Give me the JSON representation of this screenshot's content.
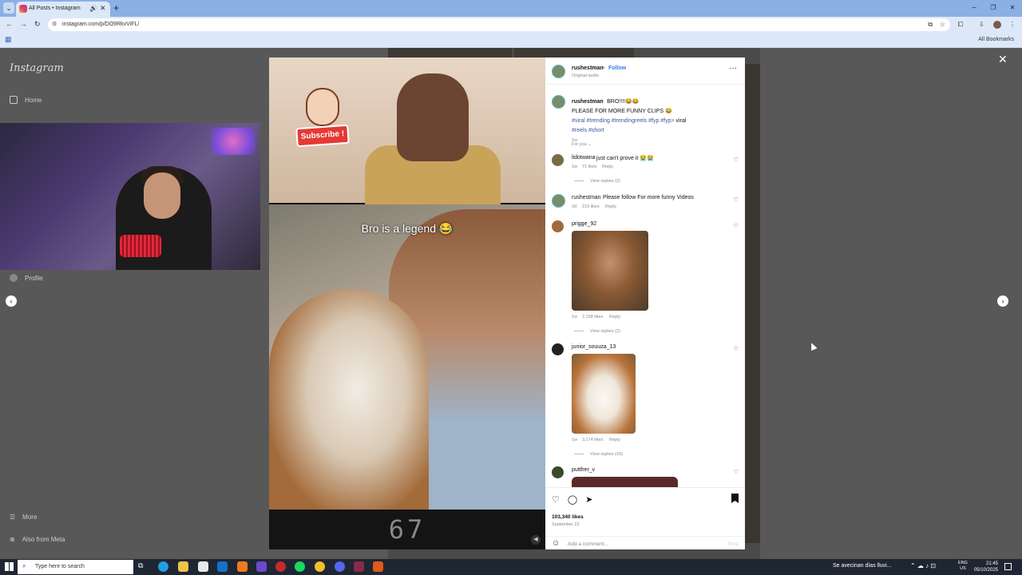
{
  "browser": {
    "tab_title": "All Posts • Instagram",
    "url": "instagram.com/p/DO9RkvViFL/",
    "all_bookmarks": "All Bookmarks"
  },
  "sidebar": {
    "logo": "Instagram",
    "home": "Home",
    "profile": "Profile",
    "more": "More",
    "also_from_meta": "Also from Meta"
  },
  "video": {
    "subscribe_label": "Subscribe !",
    "caption": "Bro is a legend 😂",
    "counter": "67"
  },
  "post": {
    "author": "rushestman",
    "follow": "Follow",
    "audio": "Original audio",
    "caption_text": "BRO!!!!😂😂",
    "caption_line2": "PLEASE FOR MORE FUNNY CLIPS 😂",
    "hashtags_1": "#viral #trending #trendingreels #fyp #fyp>",
    "hashtags_1_tail": " viral",
    "hashtags_2": "#reels #short",
    "caption_time": "1w",
    "for_you": "For you ⌄",
    "likes": "103,340 likes",
    "date": "September 23"
  },
  "comments": [
    {
      "user": "lidotwana",
      "text": "just can't prove it 😭😭",
      "time": "1w",
      "likes": "71 likes",
      "reply": "Reply",
      "view_replies": "View replies (2)"
    },
    {
      "user": "rushestman",
      "text": "Please follow For more funny Videos",
      "time": "2d",
      "likes": "219 likes",
      "reply": "Reply"
    },
    {
      "user": "prigge_92",
      "text": "",
      "time": "1w",
      "likes": "2,198 likes",
      "reply": "Reply",
      "view_replies": "View replies (2)"
    },
    {
      "user": "junior_souuza_13",
      "text": "",
      "time": "1w",
      "likes": "3,174 likes",
      "reply": "Reply",
      "view_replies": "View replies (10)"
    },
    {
      "user": "putther_v",
      "text": ""
    }
  ],
  "comment_box": {
    "placeholder": "Add a comment...",
    "post": "Post"
  },
  "taskbar": {
    "search_placeholder": "Type here to search",
    "weather": "Se avecinan días lluvi...",
    "lang_1": "ENG",
    "lang_2": "US",
    "time": "21:45",
    "date": "05/10/2025"
  }
}
